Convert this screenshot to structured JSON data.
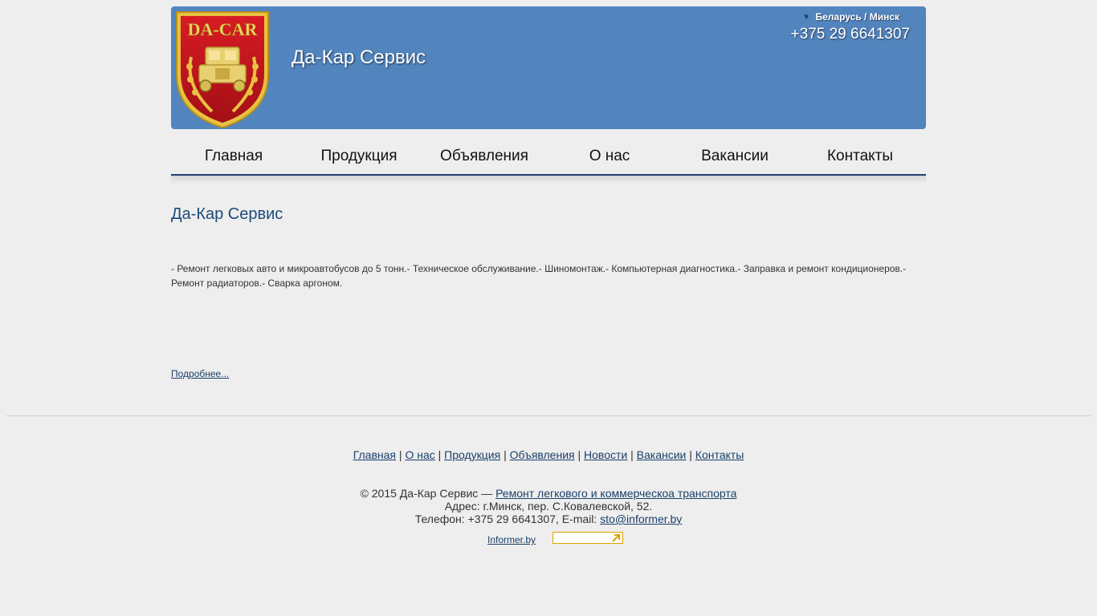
{
  "header": {
    "logo_text": "DA-CAR",
    "site_title": "Да-Кар Сервис",
    "region": "Беларусь / Минск",
    "phone": "+375 29 6641307"
  },
  "nav": [
    {
      "label": "Главная"
    },
    {
      "label": "Продукция"
    },
    {
      "label": "Объявления"
    },
    {
      "label": "О нас"
    },
    {
      "label": "Вакансии"
    },
    {
      "label": "Контакты"
    }
  ],
  "content": {
    "title": "Да-Кар Сервис",
    "description": "- Ремонт легковых авто и микроавтобусов до 5 тонн.- Техническое обслуживание.- Шиномонтаж.- Компьютерная диагностика.- Заправка и ремонт кондиционеров.- Ремонт радиаторов.- Сварка аргоном.",
    "more_link": "Подробнее..."
  },
  "footer_nav": [
    {
      "label": "Главная"
    },
    {
      "label": "О нас"
    },
    {
      "label": "Продукция"
    },
    {
      "label": "Объявления"
    },
    {
      "label": "Новости"
    },
    {
      "label": "Вакансии"
    },
    {
      "label": "Контакты"
    }
  ],
  "footer": {
    "copyright_prefix": "© 2015 Да-Кар Сервис — ",
    "copyright_link": "Ремонт легкового и коммерческоа транспорта",
    "address": "Адрес: г.Минск, пер. С.Ковалевской, 52.",
    "phone_prefix": "Телефон: +375 29 6641307, E-mail: ",
    "email": "sto@informer.by",
    "informer_link": "Informer.by"
  },
  "colors": {
    "header_bg": "#5284be",
    "nav_underline": "#20406f",
    "link": "#1a3f6a",
    "title": "#1a4a7a"
  }
}
